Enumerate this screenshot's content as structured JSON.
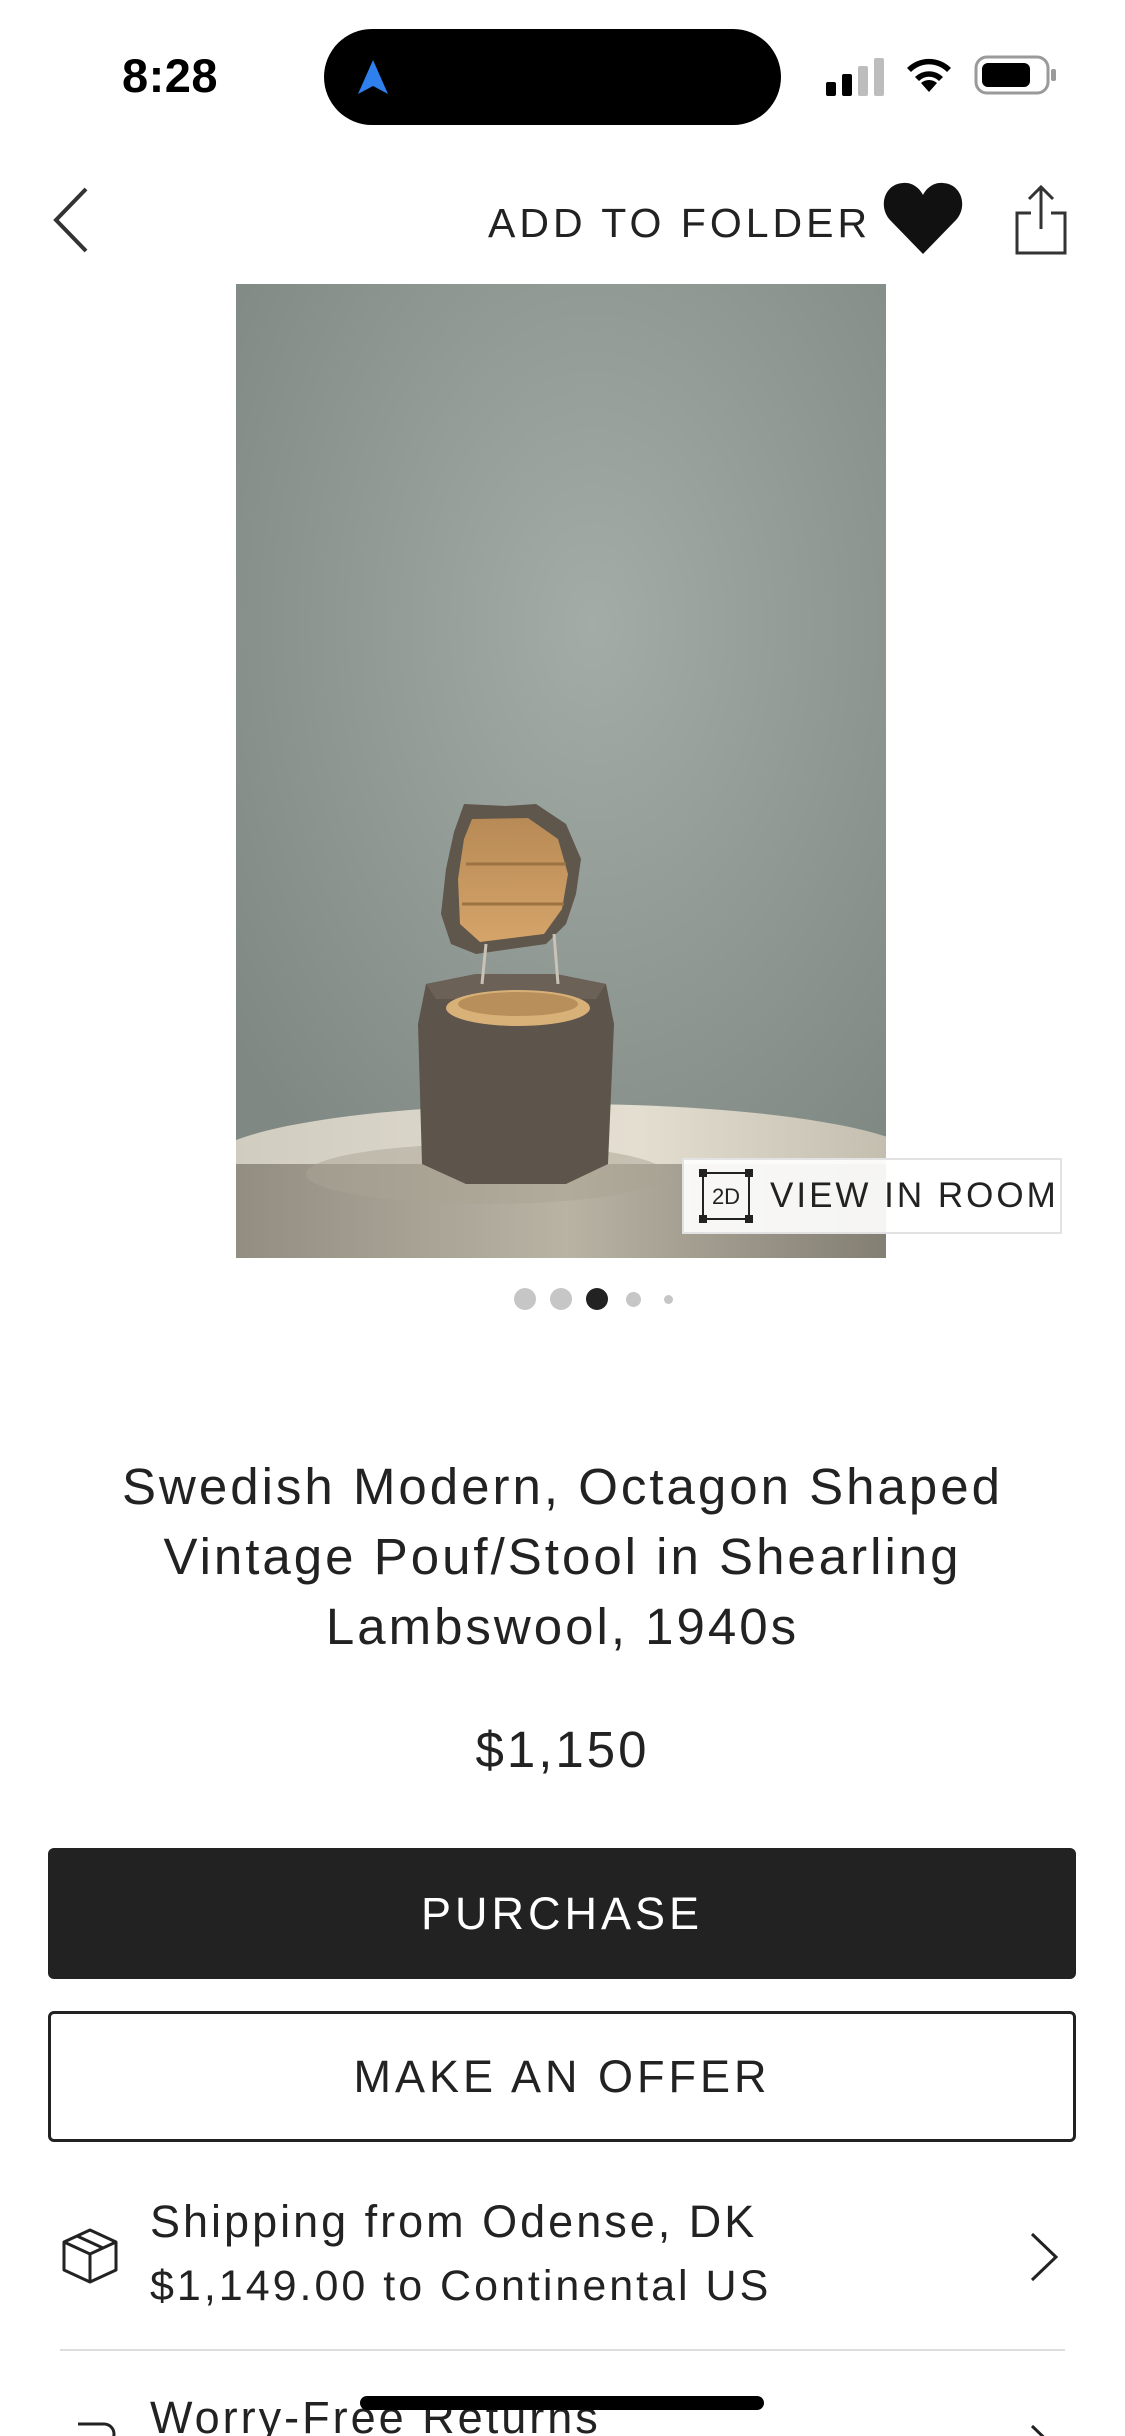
{
  "status_bar": {
    "time": "8:28"
  },
  "top_bar": {
    "add_to_folder_label": "ADD TO FOLDER"
  },
  "image": {
    "view_in_room_icon_text": "2D",
    "view_in_room_label": "VIEW IN ROOM",
    "pagination": {
      "total": 5,
      "active_index": 2
    }
  },
  "product": {
    "title": "Swedish Modern, Octagon Shaped Vintage Pouf/Stool in Shearling Lambswool, 1940s",
    "price": "$1,150"
  },
  "actions": {
    "purchase_label": "PURCHASE",
    "offer_label": "MAKE AN OFFER"
  },
  "shipping": {
    "title": "Shipping from Odense, DK",
    "subtitle": "$1,149.00 to Continental US"
  },
  "returns": {
    "title": "Worry-Free Returns"
  },
  "colors": {
    "primary_dark": "#222222",
    "accent_nav": "#2f80ed",
    "background": "#ffffff"
  }
}
